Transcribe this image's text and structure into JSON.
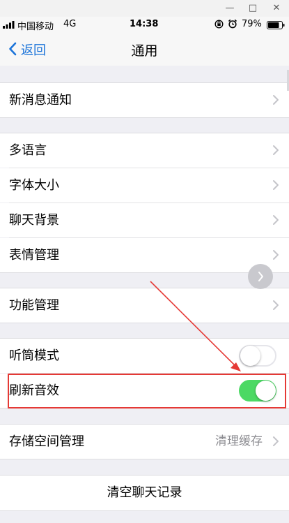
{
  "window": {
    "minimize": "—",
    "maximize": "□",
    "close": "✕"
  },
  "status": {
    "carrier": "中国移动",
    "network": "4G",
    "time": "14:38",
    "battery": "79%"
  },
  "nav": {
    "back_label": "返回",
    "title": "通用"
  },
  "rows": {
    "notifications": "新消息通知",
    "language": "多语言",
    "font_size": "字体大小",
    "chat_background": "聊天背景",
    "sticker_management": "表情管理",
    "feature_management": "功能管理",
    "earpiece_mode": "听筒模式",
    "refresh_sound": "刷新音效",
    "storage_management": "存储空间管理",
    "storage_value": "清理缓存",
    "clear_chat_history": "清空聊天记录"
  },
  "toggles": {
    "earpiece_mode": false,
    "refresh_sound": true
  },
  "colors": {
    "accent": "#1a73d9",
    "toggle_on": "#4cd964",
    "highlight": "#e53935",
    "background": "#efeff4"
  }
}
